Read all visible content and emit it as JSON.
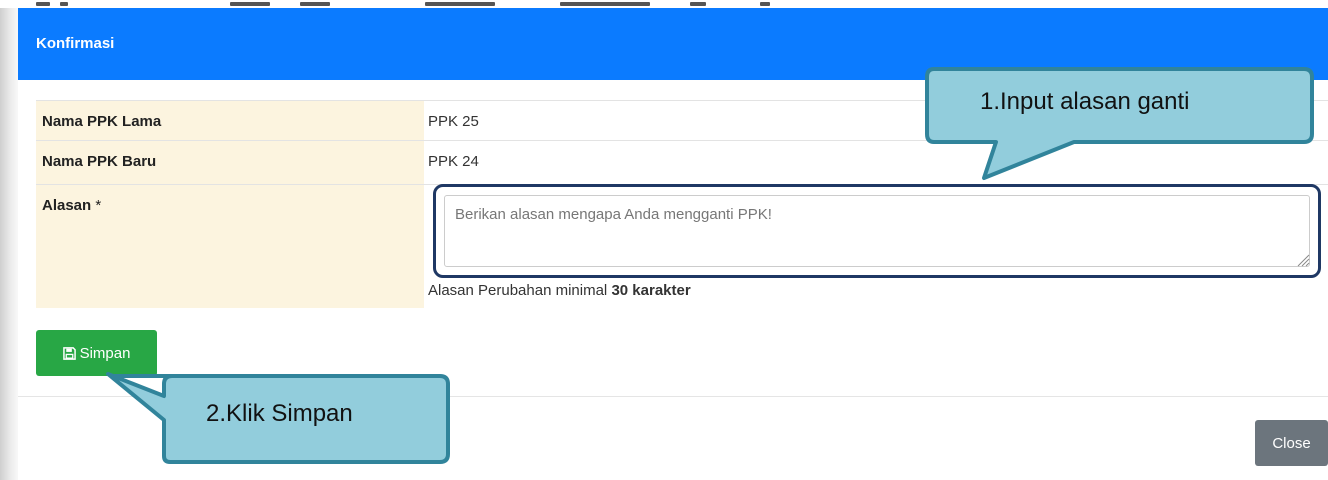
{
  "modal": {
    "title": "Konfirmasi",
    "header_color": "#0b7bff"
  },
  "form": {
    "rows": [
      {
        "label": "Nama PPK Lama",
        "value": "PPK 25"
      },
      {
        "label": "Nama PPK Baru",
        "value": "PPK 24"
      }
    ],
    "alasan": {
      "label": "Alasan",
      "required_mark": "*",
      "value": "",
      "placeholder": "Berikan alasan mengapa Anda mengganti PPK!",
      "helper_prefix": "Alasan Perubahan minimal",
      "helper_bold": "30 karakter"
    }
  },
  "buttons": {
    "simpan_label": "Simpan",
    "simpan_icon": "floppy-disk-icon",
    "simpan_color": "#28a745",
    "close_label": "Close",
    "close_color": "#6c757d"
  },
  "annotations": {
    "callout_1": "1.Input alasan ganti",
    "callout_2": "2.Klik Simpan",
    "callout_fill": "#92cddc",
    "callout_border": "#31849b",
    "highlight_border": "#1f3864"
  }
}
